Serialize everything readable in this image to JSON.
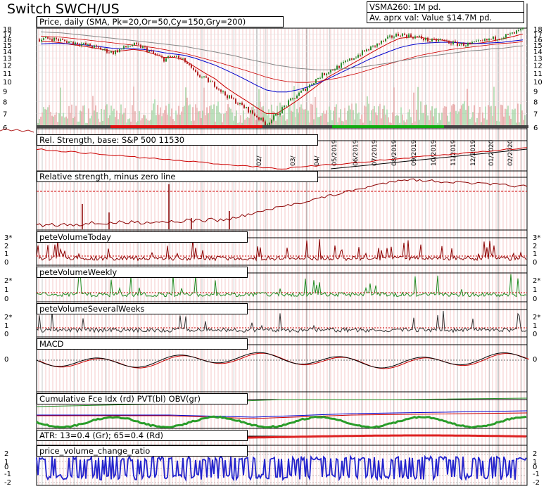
{
  "title": "Switch SWCH/US",
  "info": {
    "vsma": "VSMA260: 1M pd.",
    "avval": "Av. aprx val: Value $14.7M pd."
  },
  "panels": {
    "price": "Price, daily (SMA, Pk=20,Or=50,Cy=150,Gry=200)",
    "rs": "Rel. Strength, base: S&P 500 11530",
    "rsz": "Relative strength, minus zero line",
    "pvt": "peteVolumeToday",
    "pvw": "peteVolumeWeekly",
    "pvs": "peteVolumeSeveralWeeks",
    "macd": "MACD",
    "cum": "Cumulative Fce Idx (rd) PVT(bl) OBV(gr)",
    "atr": "ATR: 13=0.4 (Gr); 65=0.4 (Rd)",
    "pvcr": "price_volume_change_ratio"
  },
  "price_axis_ticks": [
    "18",
    "17",
    "16",
    "15",
    "14",
    "13",
    "12",
    "11",
    "10",
    "9",
    "8",
    "7",
    "6"
  ],
  "month_labels": [
    "02/",
    "03/",
    "04/",
    "05/2019",
    "06/2019",
    "07/2019",
    "08/2019",
    "09/2019",
    "10/2019",
    "11/2019",
    "12/2019",
    "01/2020",
    "02/2020"
  ],
  "axis_labels": {
    "pvt": [
      "3*",
      "2",
      "1",
      "0"
    ],
    "pvw": [
      "2*",
      "1",
      "0"
    ],
    "pvs": [
      "2*",
      "1",
      "0"
    ],
    "macd": [
      "0"
    ],
    "pvcr": [
      "2",
      "1",
      "0",
      "-1",
      "-2"
    ]
  },
  "colors": {
    "price_up": "#2e8b2e",
    "price_down": "#b22222",
    "sma20": "#cc0000",
    "sma50": "#0000cc",
    "sma150": "#cc0000",
    "sma200": "#888888",
    "volume_today": "#8b0000",
    "volume_weekly": "#228b22",
    "volume_several": "#333333",
    "atr13": "#2a9d2a",
    "atr65": "#dd2222",
    "pvcr": "#2222cc"
  },
  "chart_data": {
    "type": "line",
    "x_range": [
      "2018-11",
      "2020-02"
    ],
    "ylim": [
      6,
      18
    ],
    "y_scale": "log",
    "series": [
      {
        "name": "Price",
        "values": [
          16.0,
          16.2,
          15.8,
          15.5,
          15.2,
          14.8,
          14.3,
          13.8,
          14.5,
          15.1,
          14.6,
          13.6,
          12.8,
          13.3,
          12.6,
          11.0,
          10.3,
          9.6,
          8.6,
          8.0,
          7.4,
          6.8,
          6.2,
          6.9,
          7.8,
          8.6,
          9.4,
          10.4,
          11.2,
          11.8,
          12.6,
          13.5,
          14.4,
          15.3,
          16.3,
          17.0,
          16.6,
          16.3,
          15.7,
          15.9,
          15.4,
          15.1,
          15.2,
          15.6,
          16.1,
          16.5,
          17.0,
          17.9
        ]
      },
      {
        "name": "SMA 20",
        "values": [
          15.7,
          15.6,
          15.4,
          15.1,
          14.9,
          14.6,
          14.3,
          14.0,
          14.1,
          14.3,
          14.1,
          13.6,
          13.1,
          13.1,
          12.7,
          11.8,
          11.0,
          10.3,
          9.4,
          8.7,
          8.1,
          7.5,
          7.0,
          7.0,
          7.5,
          8.1,
          8.8,
          9.6,
          10.5,
          11.2,
          11.9,
          12.7,
          13.6,
          14.5,
          15.4,
          16.2,
          16.4,
          16.4,
          16.0,
          15.9,
          15.6,
          15.3,
          15.2,
          15.4,
          15.7,
          16.1,
          16.5,
          17.0
        ]
      },
      {
        "name": "SMA 50",
        "values": [
          15.2,
          15.3,
          15.3,
          15.2,
          15.1,
          14.9,
          14.7,
          14.5,
          14.4,
          14.4,
          14.3,
          14.1,
          13.8,
          13.6,
          13.4,
          13.0,
          12.5,
          12.0,
          11.4,
          10.8,
          10.2,
          9.6,
          9.1,
          8.9,
          8.9,
          9.1,
          9.4,
          9.8,
          10.3,
          10.9,
          11.5,
          12.1,
          12.8,
          13.4,
          14.0,
          14.6,
          15.0,
          15.3,
          15.4,
          15.5,
          15.5,
          15.4,
          15.3,
          15.3,
          15.4,
          15.5,
          15.7,
          15.9
        ]
      },
      {
        "name": "SMA 150",
        "values": [
          16.6,
          16.5,
          16.4,
          16.2,
          16.0,
          15.8,
          15.6,
          15.4,
          15.2,
          15.0,
          14.8,
          14.6,
          14.3,
          14.0,
          13.7,
          13.3,
          12.9,
          12.5,
          12.1,
          11.7,
          11.3,
          10.9,
          10.5,
          10.2,
          10.0,
          9.9,
          9.9,
          10.0,
          10.2,
          10.4,
          10.7,
          11.0,
          11.4,
          11.8,
          12.2,
          12.6,
          13.0,
          13.4,
          13.7,
          14.0,
          14.3,
          14.5,
          14.7,
          14.9,
          15.1,
          15.3,
          15.4,
          15.6
        ]
      },
      {
        "name": "SMA 200",
        "values": [
          17.4,
          17.3,
          17.2,
          17.0,
          16.8,
          16.6,
          16.4,
          16.2,
          16.0,
          15.8,
          15.6,
          15.4,
          15.2,
          15.0,
          14.8,
          14.5,
          14.2,
          13.9,
          13.6,
          13.3,
          12.9,
          12.6,
          12.3,
          12.0,
          11.8,
          11.6,
          11.5,
          11.4,
          11.4,
          11.5,
          11.6,
          11.7,
          11.9,
          12.1,
          12.3,
          12.6,
          12.8,
          13.1,
          13.3,
          13.5,
          13.7,
          13.9,
          14.1,
          14.2,
          14.4,
          14.5,
          14.7,
          14.9
        ]
      }
    ]
  }
}
